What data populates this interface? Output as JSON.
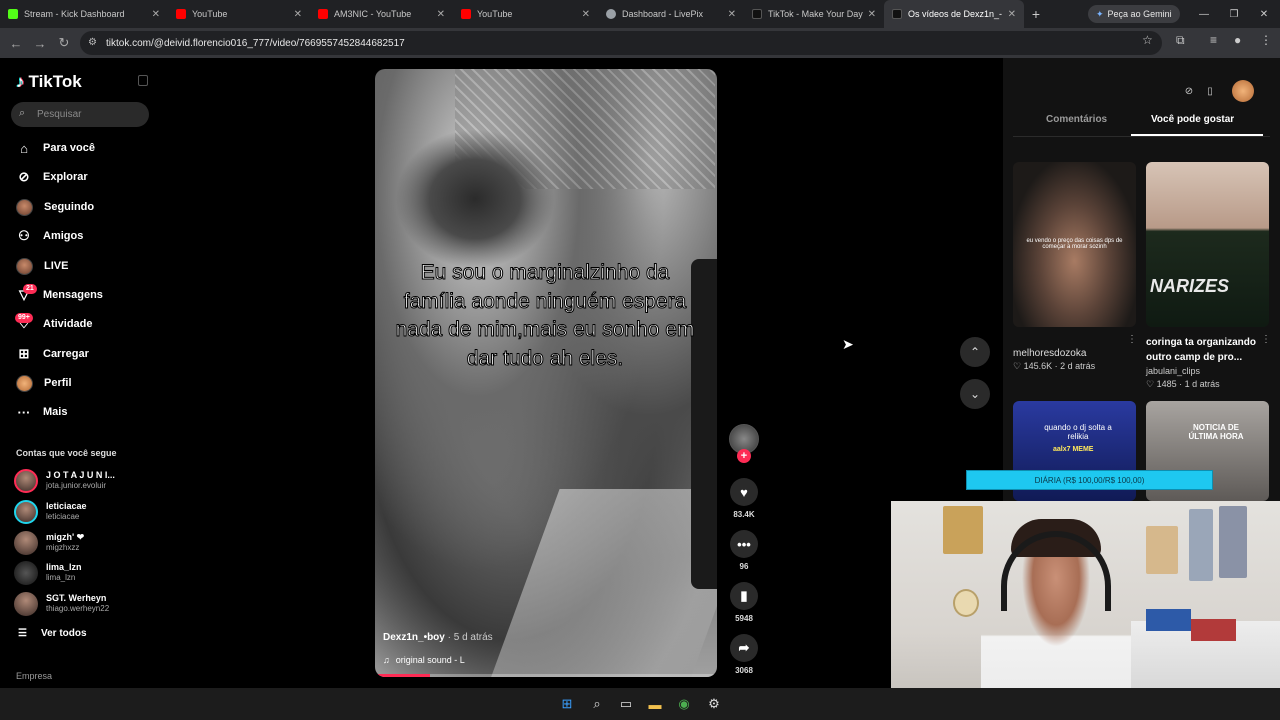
{
  "browser": {
    "tabs": [
      {
        "label": "Stream - Kick Dashboard",
        "color": "#53fc18"
      },
      {
        "label": "YouTube",
        "color": "#ff0000"
      },
      {
        "label": "AM3NIC - YouTube",
        "color": "#ff0000"
      },
      {
        "label": "YouTube",
        "color": "#ff0000"
      },
      {
        "label": "Dashboard - LivePix",
        "color": "#9aa0a6"
      },
      {
        "label": "TikTok - Make Your Day",
        "color": "#111111"
      },
      {
        "label": "Os vídeos de Dexz1n_-",
        "color": "#111111"
      }
    ],
    "gemini_label": "Peça ao Gemini",
    "url": "tiktok.com/@deivid.florencio016_777/video/7669557452844682517"
  },
  "sidebar": {
    "logo": "TikTok",
    "search_placeholder": "Pesquisar",
    "nav": [
      {
        "label": "Para você",
        "icon": "home-icon"
      },
      {
        "label": "Explorar",
        "icon": "compass-icon"
      },
      {
        "label": "Seguindo",
        "icon": "avatar"
      },
      {
        "label": "Amigos",
        "icon": "friends-icon"
      },
      {
        "label": "LIVE",
        "icon": "avatar"
      },
      {
        "label": "Mensagens",
        "icon": "message-icon",
        "badge": "21"
      },
      {
        "label": "Atividade",
        "icon": "activity-icon",
        "badge": "99+"
      },
      {
        "label": "Carregar",
        "icon": "upload-icon"
      },
      {
        "label": "Perfil",
        "icon": "avatar"
      },
      {
        "label": "Mais",
        "icon": "more-icon"
      }
    ],
    "following_heading": "Contas que você segue",
    "accounts": [
      {
        "name": "J O T A J U N I...",
        "handle": "jota.junior.evoluir"
      },
      {
        "name": "leticiacae",
        "handle": "leticiacae"
      },
      {
        "name": "migzh' ❤",
        "handle": "migzhxzz"
      },
      {
        "name": "lima_lzn",
        "handle": "lima_lzn"
      },
      {
        "name": "SGT. Werheyn",
        "handle": "thiago.werheyn22"
      }
    ],
    "see_all": "Ver todos",
    "footer": "Empresa"
  },
  "video": {
    "caption": "Eu sou o marginalzinho da família aonde ninguém espera nada de mim,mais eu sonho em dar tudo ah eles.",
    "author": "Dexz1n_•boy",
    "time_ago": "· 5 d atrás",
    "sound": "original sound - L",
    "progress": 0.16,
    "likes": "83.4K",
    "comments": "96",
    "saves": "5948",
    "shares": "3068"
  },
  "right_panel": {
    "tab_comments": "Comentários",
    "tab_recommended": "Você pode gostar",
    "items": [
      {
        "title": "melhoresdozoka",
        "likes": "145.6K",
        "time": "2 d atrás",
        "thumb_text": "eu vendo o preço das coisas dps de começar a morar sozinh"
      },
      {
        "title": "coringa ta organizando outro camp de pro...",
        "author": "jabulani_clips",
        "likes": "1485",
        "time": "1 d atrás",
        "thumb_text": "NARIZES"
      },
      {
        "thumb_text": "quando o dj solta a relikia",
        "thumb_sub": "aalx7 MEME"
      },
      {
        "thumb_text": "NOTICIA DE ÚLTIMA HORA"
      }
    ]
  },
  "overlay": {
    "banner": "DIÁRIA (R$ 100,00/R$ 100,00)"
  }
}
